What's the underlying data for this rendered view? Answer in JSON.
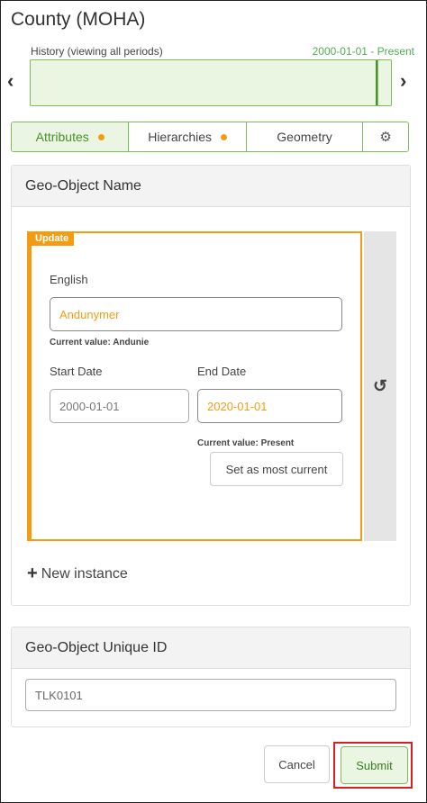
{
  "header": {
    "title": "County (MOHA)",
    "history_label": "History  (viewing all periods)",
    "history_range": "2000-01-01 - Present"
  },
  "tabs": [
    {
      "label": "Attributes",
      "has_dot": true,
      "active": true
    },
    {
      "label": "Hierarchies",
      "has_dot": true,
      "active": false
    },
    {
      "label": "Geometry",
      "has_dot": false,
      "active": false
    },
    {
      "label": "",
      "icon": "gear-icon",
      "active": false
    }
  ],
  "name_panel": {
    "title": "Geo-Object Name",
    "badge": "Update",
    "language_label": "English",
    "name_value": "Andunymer",
    "name_current": "Current value: Andunie",
    "start_label": "Start Date",
    "start_value": "2000-01-01",
    "end_label": "End Date",
    "end_value": "2020-01-01",
    "end_current": "Current value: Present",
    "most_current_button": "Set as most current",
    "new_instance": "New instance"
  },
  "id_panel": {
    "title": "Geo-Object Unique ID",
    "value": "TLK0101"
  },
  "footer": {
    "cancel": "Cancel",
    "submit": "Submit"
  },
  "colors": {
    "accent_green": "#7bbf5a",
    "changed_orange": "#f39c12",
    "highlight_red": "#d42020"
  }
}
